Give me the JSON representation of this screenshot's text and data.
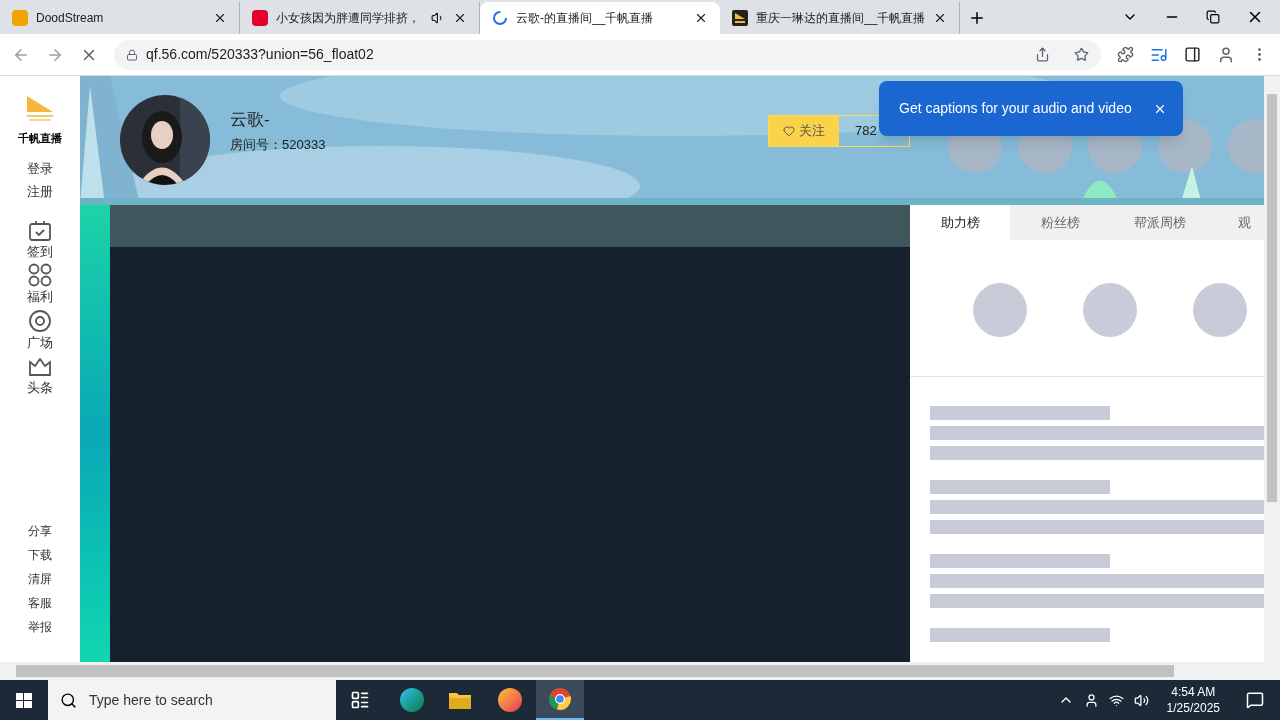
{
  "browser_tabs": [
    {
      "title": "DoodStream",
      "selected": false,
      "kind": "dood",
      "audio": false
    },
    {
      "title": "小女孩因为胖遭同学排挤，",
      "selected": false,
      "kind": "fiftysix",
      "audio": true
    },
    {
      "title": "云歌-的直播间__千帆直播",
      "selected": true,
      "kind": "loading",
      "audio": false
    },
    {
      "title": "重庆一琳达的直播间__千帆直播",
      "selected": false,
      "kind": "qf",
      "audio": false
    }
  ],
  "address_bar": {
    "url": "qf.56.com/520333?union=56_float02"
  },
  "sidebar": {
    "logo_text": "千帆直播",
    "account_links": [
      "登录",
      "注册"
    ],
    "items": [
      {
        "label": "签到",
        "kind": "calendar"
      },
      {
        "label": "福利",
        "kind": "grid"
      },
      {
        "label": "广场",
        "kind": "disc"
      },
      {
        "label": "头条",
        "kind": "crown"
      }
    ],
    "footer_links": [
      "分享",
      "下载",
      "清屏",
      "客服",
      "举报"
    ]
  },
  "streamer": {
    "name": "云歌-",
    "room_id": "房间号：520333",
    "follow_button": "关注",
    "follower_count": "782"
  },
  "caption_popup": {
    "text": "Get captions for your audio and video"
  },
  "ranking_tabs": [
    {
      "label": "助力榜",
      "selected": true
    },
    {
      "label": "粉丝榜",
      "selected": false
    },
    {
      "label": "帮派周榜",
      "selected": false
    },
    {
      "label": "观",
      "selected": false
    }
  ],
  "taskbar": {
    "search_placeholder": "Type here to search",
    "time": "4:54 AM",
    "date": "1/25/2025"
  }
}
